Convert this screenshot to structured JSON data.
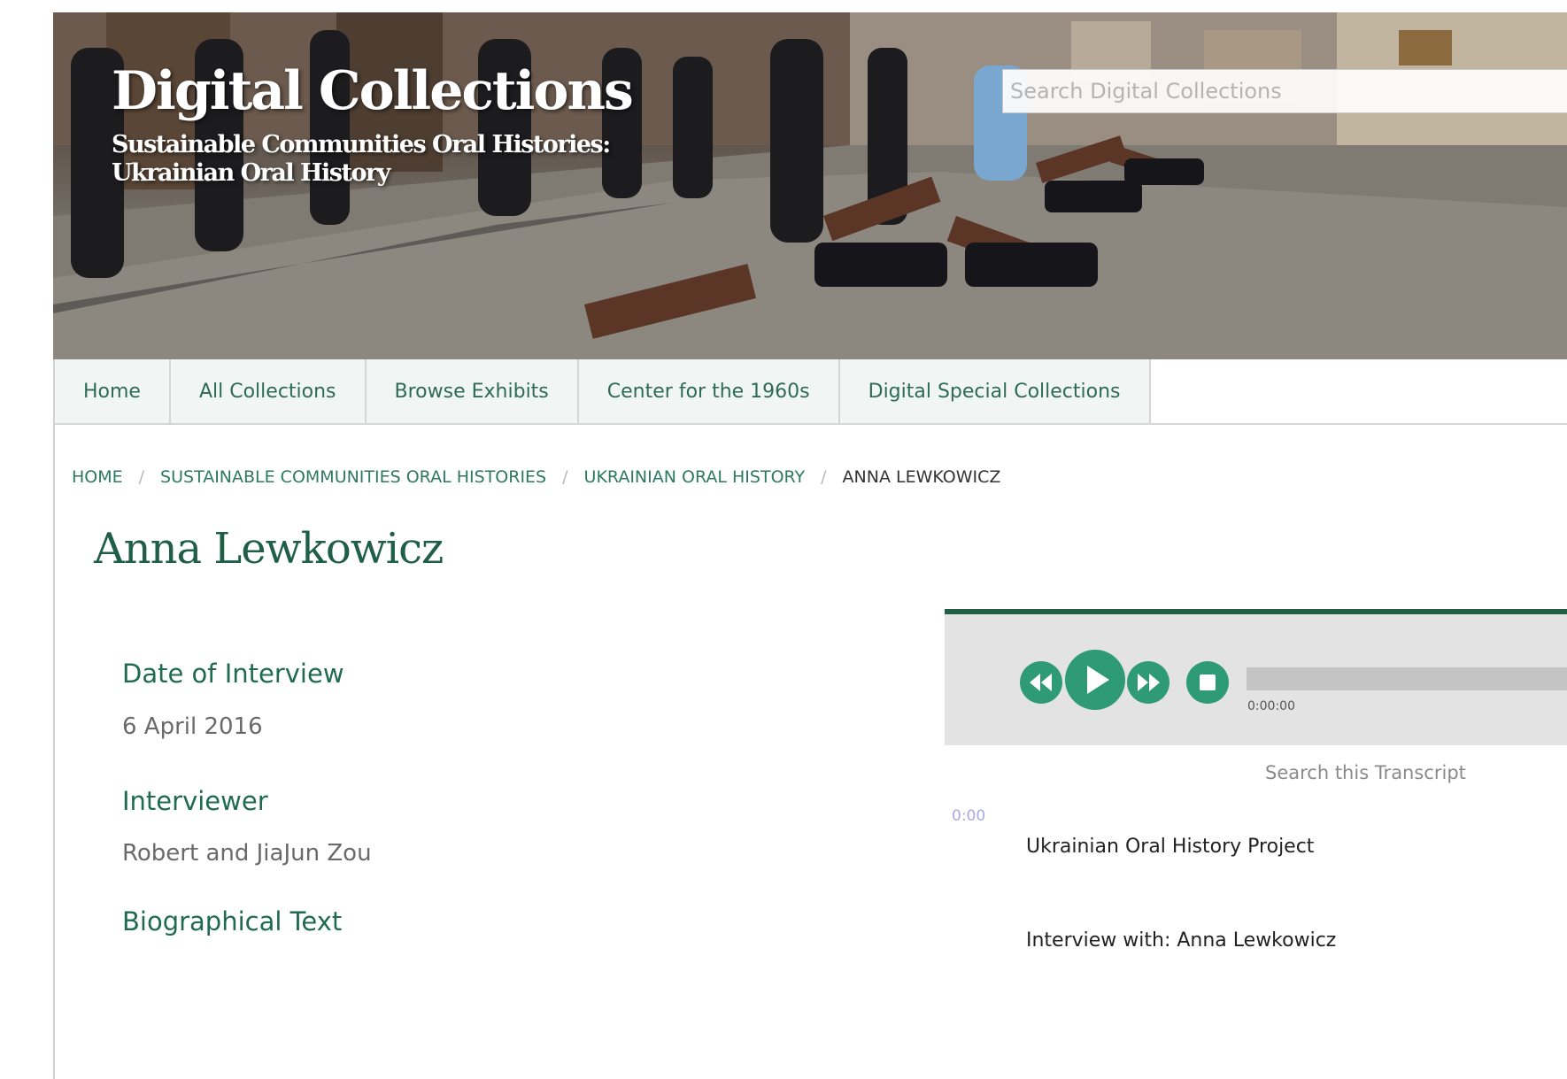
{
  "header": {
    "site_title": "Digital Collections",
    "subtitle_line1": "Sustainable Communities Oral Histories:",
    "subtitle_line2": "Ukrainian Oral History",
    "search_placeholder": "Search Digital Collections"
  },
  "nav": {
    "items": [
      {
        "label": "Home"
      },
      {
        "label": "All Collections"
      },
      {
        "label": "Browse Exhibits"
      },
      {
        "label": "Center for the 1960s"
      },
      {
        "label": "Digital Special Collections"
      }
    ]
  },
  "breadcrumb": {
    "items": [
      {
        "label": "HOME"
      },
      {
        "label": "SUSTAINABLE COMMUNITIES ORAL HISTORIES"
      },
      {
        "label": "UKRAINIAN ORAL HISTORY"
      }
    ],
    "separator": "/",
    "current": "ANNA LEWKOWICZ"
  },
  "item": {
    "title": "Anna Lewkowicz",
    "fields": [
      {
        "label": "Date of Interview",
        "value": "6 April 2016"
      },
      {
        "label": "Interviewer",
        "value": "Robert and JiaJun Zou"
      },
      {
        "label": "Biographical Text",
        "value": ""
      }
    ]
  },
  "player": {
    "controls": [
      "rewind-icon",
      "play-icon",
      "fast-forward-icon",
      "stop-icon"
    ],
    "time": "0:00:00",
    "progress": 0,
    "accent_color": "#2f9a76",
    "search_placeholder": "Search this Transcript",
    "transcript": {
      "timestamp": "0:00",
      "lines": [
        "Ukrainian Oral History Project",
        "Interview with: Anna Lewkowicz"
      ]
    }
  },
  "colors": {
    "brand_green": "#1f5e47",
    "link_green": "#2e7a5e",
    "nav_bg": "#f1f6f4"
  }
}
